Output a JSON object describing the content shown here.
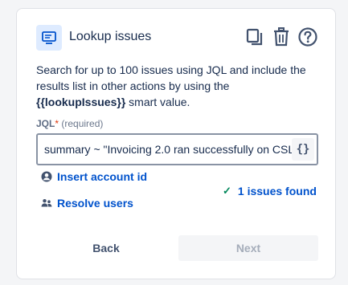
{
  "header": {
    "title": "Lookup issues",
    "icons": [
      "lookup-issues-icon",
      "copy-icon",
      "delete-icon",
      "help-icon"
    ]
  },
  "description": {
    "text_before": "Search for up to 100 issues using JQL and include the results list in other actions by using the ",
    "smart_value": "{{lookupIssues}}",
    "text_after": " smart value."
  },
  "jql_field": {
    "label": "JQL",
    "required_mark": "*",
    "required_text": "(required)",
    "value": "summary ~ \"Invoicing 2.0 ran successfully on CSL",
    "smart_value_button": "{}"
  },
  "links": {
    "insert_account_id": "Insert account id",
    "resolve_users": "Resolve users"
  },
  "status": {
    "found_text": "1 issues found"
  },
  "footer": {
    "back_label": "Back",
    "next_label": "Next"
  },
  "colors": {
    "accent": "#0052cc",
    "success": "#00875a",
    "icon_bg": "#deebff",
    "disabled_text": "#a5adba"
  }
}
